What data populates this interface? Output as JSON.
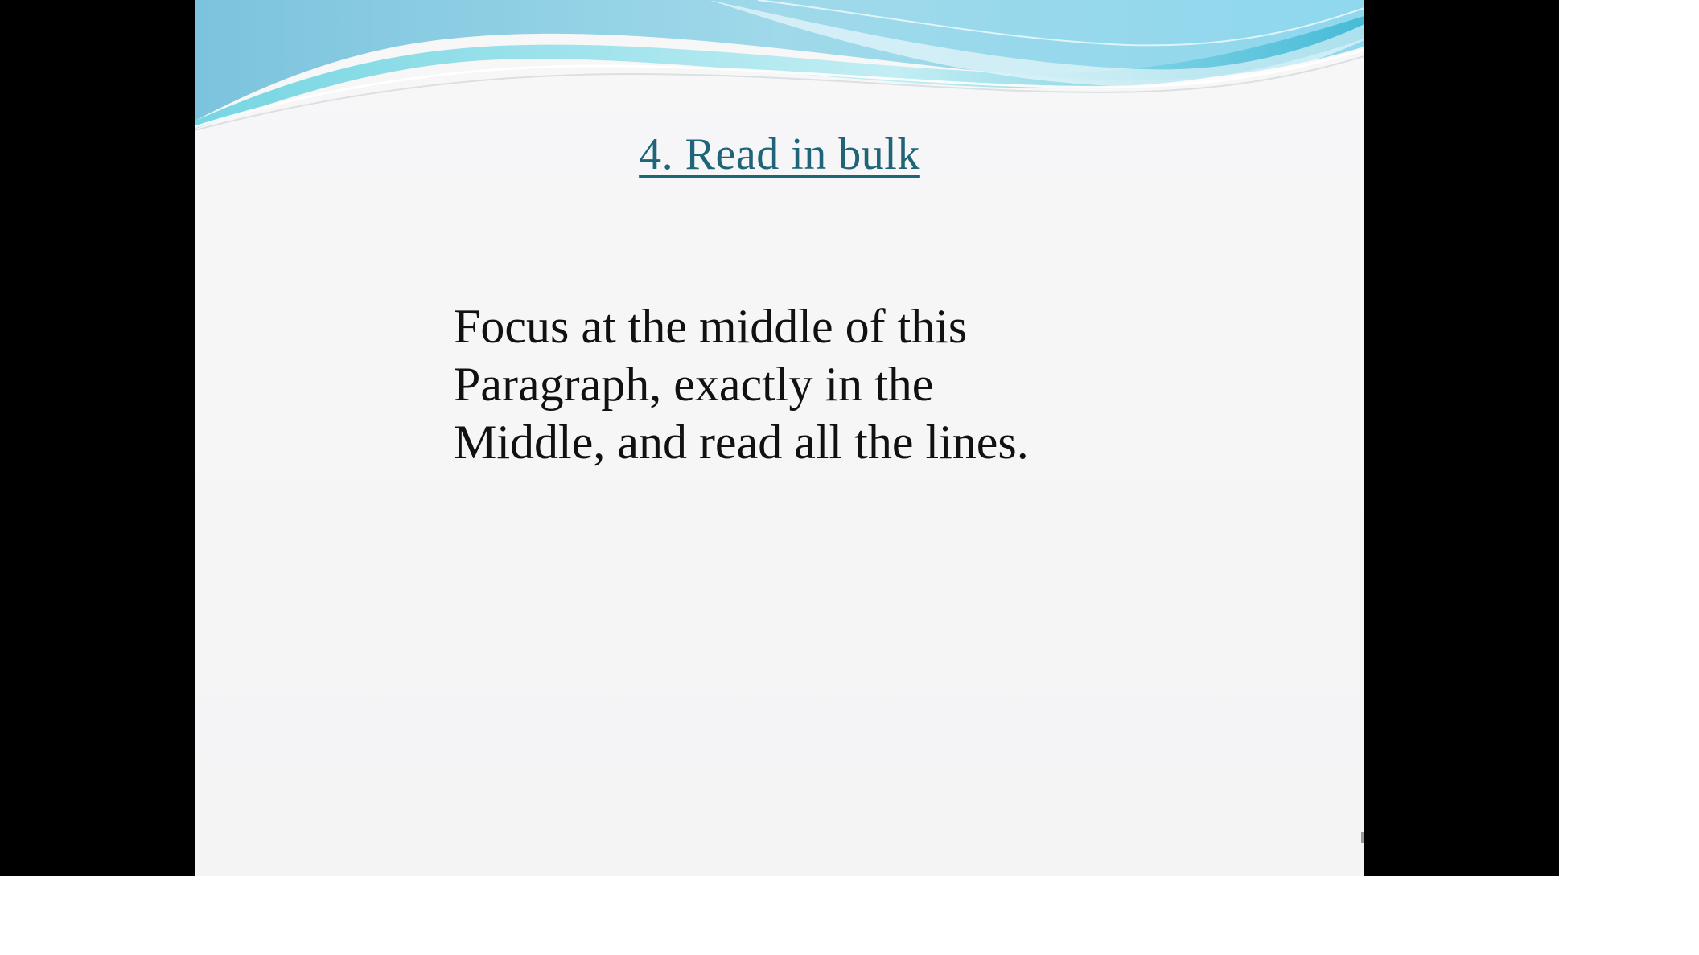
{
  "slide": {
    "title": "4. Read in bulk",
    "body_lines": [
      "Focus at the middle of this",
      "Paragraph, exactly in the",
      "Middle, and read all the lines."
    ]
  },
  "colors": {
    "letterbox": "#000000",
    "slide_background": "#f6f6f7",
    "title_color": "#1f6577",
    "body_text": "#111111",
    "wave_light": "#b6e8f0",
    "wave_mid": "#7fd3e3",
    "wave_dark": "#2aa8c4"
  }
}
